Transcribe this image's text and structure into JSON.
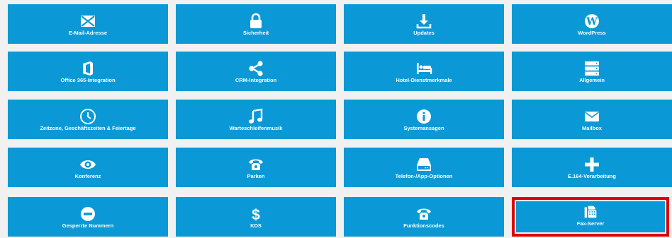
{
  "colors": {
    "tile": "#0a99d6",
    "background": "#f1f1f1",
    "highlight": "#e00000",
    "text": "#ffffff"
  },
  "tiles": [
    {
      "label": "E-Mail-Adresse",
      "icon": "envelope-x-icon"
    },
    {
      "label": "Sicherheit",
      "icon": "lock-icon"
    },
    {
      "label": "Updates",
      "icon": "download-icon"
    },
    {
      "label": "WordPress",
      "icon": "wordpress-icon"
    },
    {
      "label": "Office 365-Integration",
      "icon": "office-icon"
    },
    {
      "label": "CRM-Integration",
      "icon": "share-icon"
    },
    {
      "label": "Hotel-Dienstmerkmale",
      "icon": "bed-icon"
    },
    {
      "label": "Allgemein",
      "icon": "server-icon"
    },
    {
      "label": "Zeitzone, Geschäftszeiten & Feiertage",
      "icon": "clock-icon"
    },
    {
      "label": "Warteschleifenmusik",
      "icon": "music-note-icon"
    },
    {
      "label": "Systemansagen",
      "icon": "info-icon"
    },
    {
      "label": "Mailbox",
      "icon": "envelope-icon"
    },
    {
      "label": "Konferenz",
      "icon": "eye-icon"
    },
    {
      "label": "Parken",
      "icon": "phone-icon"
    },
    {
      "label": "Telefon-/App-Optionen",
      "icon": "hard-drive-icon"
    },
    {
      "label": "E.164-Verarbeitung",
      "icon": "plus-icon"
    },
    {
      "label": "Gesperrte Nummern",
      "icon": "minus-circle-icon"
    },
    {
      "label": "KDS",
      "icon": "dollar-icon"
    },
    {
      "label": "Funktionscodes",
      "icon": "phone-icon"
    },
    {
      "label": "Fax-Server",
      "icon": "fax-icon"
    }
  ]
}
